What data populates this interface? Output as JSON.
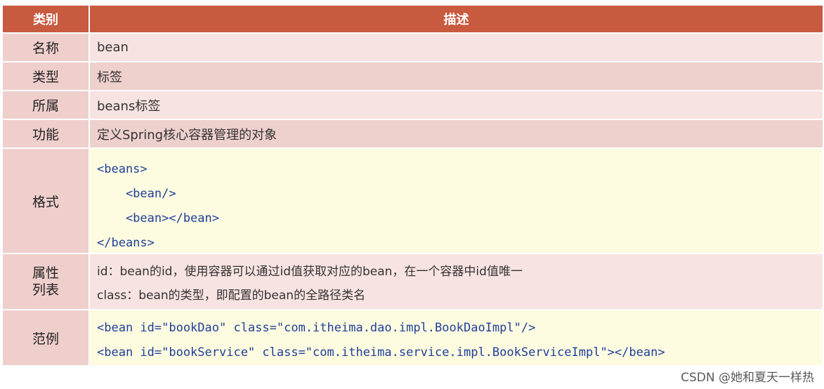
{
  "header": {
    "col1": "类别",
    "col2": "描述"
  },
  "rows": {
    "name": {
      "label": "名称",
      "value": "bean"
    },
    "type": {
      "label": "类型",
      "value": "标签"
    },
    "belongs": {
      "label": "所属",
      "value": "beans标签"
    },
    "function": {
      "label": "功能",
      "value": "定义Spring核心容器管理的对象"
    },
    "format": {
      "label": "格式",
      "lines": [
        "<beans>",
        "    <bean/>",
        "    <bean></bean>",
        "</beans>"
      ]
    },
    "attributes": {
      "label": "属性\n列表",
      "lines": [
        "id：bean的id，使用容器可以通过id值获取对应的bean，在一个容器中id值唯一",
        "class：bean的类型，即配置的bean的全路径类名"
      ]
    },
    "example": {
      "label": "范例",
      "lines": [
        "<bean id=\"bookDao\" class=\"com.itheima.dao.impl.BookDaoImpl\"/>",
        "<bean id=\"bookService\" class=\"com.itheima.service.impl.BookServiceImpl\"></bean>"
      ]
    }
  },
  "watermark": "CSDN @她和夏天一样热",
  "colors": {
    "header": "#c85a3f",
    "label_bg": "#efcfcc",
    "row_light": "#f7e3e1",
    "row_dark": "#eed0cd",
    "code_bg": "#fdfbe0",
    "code": "#1f3f9a"
  }
}
